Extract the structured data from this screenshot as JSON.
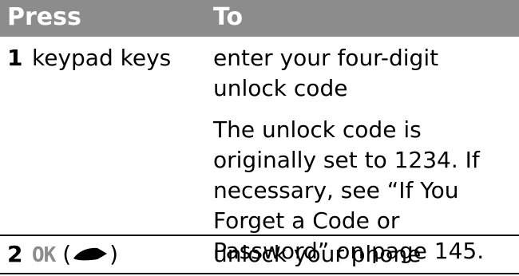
{
  "header": {
    "press_label": "Press",
    "to_label": "To"
  },
  "rows": [
    {
      "number": "1",
      "press": "keypad keys",
      "to": "enter your four-digit unlock code",
      "note": "The unlock code is originally set to 1234. If necessary, see “If You Forget a Code or Password” on page 145."
    },
    {
      "number": "2",
      "press_key": "OK",
      "press_paren_open": "(",
      "press_paren_close": ")",
      "press_icon": "right-softkey-icon",
      "to": "unlock your phone"
    }
  ],
  "colors": {
    "header_bg": "#8c8c8c",
    "header_text": "#ffffff",
    "key_text": "#8c8c8c",
    "rule": "#000000"
  }
}
